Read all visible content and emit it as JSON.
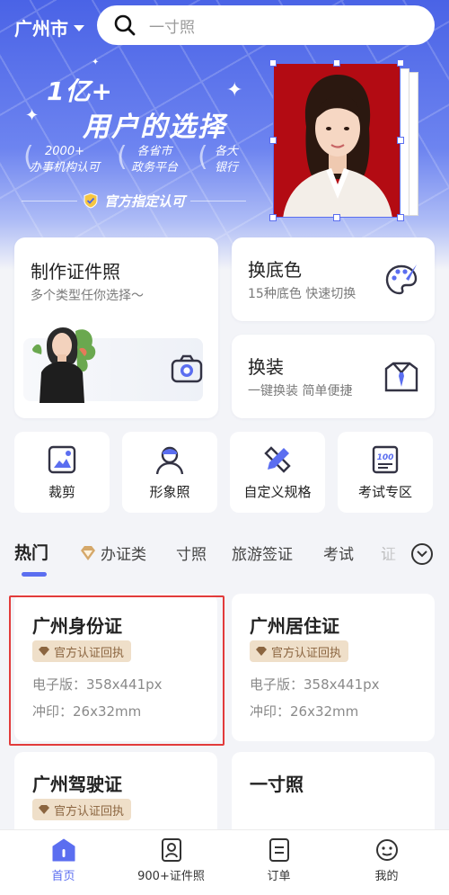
{
  "header": {
    "city": "广州市",
    "search_placeholder": "一寸照"
  },
  "banner": {
    "slogan_line1": "1亿+",
    "slogan_line2": "用户的选择",
    "features": [
      {
        "line1": "2000+",
        "line2": "办事机构认可"
      },
      {
        "line1": "各省市",
        "line2": "政务平台"
      },
      {
        "line1": "各大",
        "line2": "银行"
      }
    ],
    "official": "官方指定认可"
  },
  "cards": {
    "make_photo": {
      "title": "制作证件照",
      "subtitle": "多个类型任你选择～"
    },
    "change_bg": {
      "title": "换底色",
      "subtitle": "15种底色 快速切换"
    },
    "change_outfit": {
      "title": "换装",
      "subtitle": "一键换装 简单便捷"
    }
  },
  "tools": [
    {
      "label": "裁剪",
      "icon": "crop-icon"
    },
    {
      "label": "形象照",
      "icon": "portrait-icon"
    },
    {
      "label": "自定义规格",
      "icon": "custom-size-icon"
    },
    {
      "label": "考试专区",
      "icon": "exam-icon"
    }
  ],
  "tabs": [
    "热门",
    "办证类",
    "寸照",
    "旅游签证",
    "考试",
    "证"
  ],
  "products": [
    {
      "title": "广州身份证",
      "badge": "官方认证回执",
      "digital": "电子版：358x441px",
      "print": "冲印：26x32mm"
    },
    {
      "title": "广州居住证",
      "badge": "官方认证回执",
      "digital": "电子版：358x441px",
      "print": "冲印：26x32mm"
    },
    {
      "title": "广州驾驶证",
      "badge": "官方认证回执"
    },
    {
      "title": "一寸照"
    }
  ],
  "bottom_nav": [
    {
      "label": "首页",
      "icon": "home-icon",
      "active": true
    },
    {
      "label": "900+证件照",
      "icon": "id-photo-icon",
      "active": false
    },
    {
      "label": "订单",
      "icon": "order-icon",
      "active": false
    },
    {
      "label": "我的",
      "icon": "profile-icon",
      "active": false
    }
  ],
  "colors": {
    "brand": "#5b6ef0",
    "photo_bg": "#b30b13",
    "badge_bg": "#efdfc9",
    "highlight": "#e23b3b"
  }
}
